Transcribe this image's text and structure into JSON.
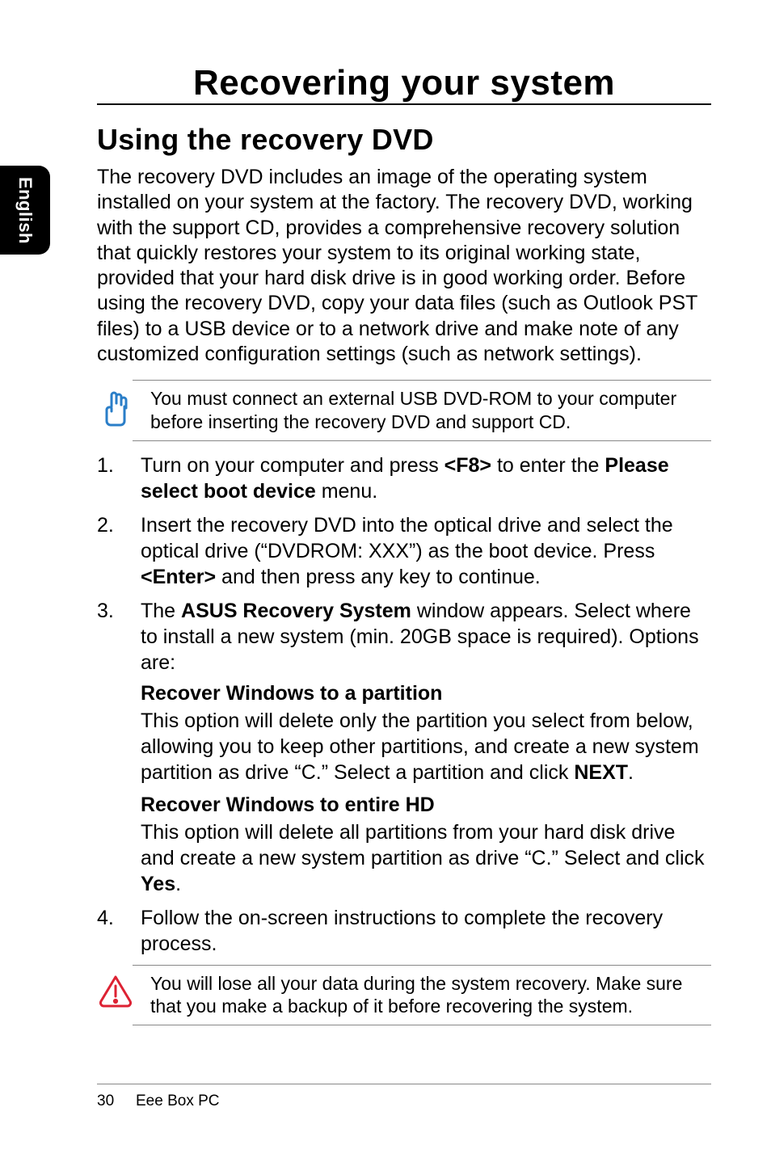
{
  "sideTab": "English",
  "title": "Recovering your system",
  "section": "Using the recovery DVD",
  "intro": "The recovery DVD includes an image of the operating system installed on your system at the factory. The recovery DVD, working with the support CD, provides a comprehensive recovery solution that quickly restores your system to its original working state, provided that your hard disk drive is in good working order. Before using the recovery DVD, copy your data files (such as Outlook PST files) to a USB device or to a network drive and make note of any customized configuration settings (such as network settings).",
  "note1": "You must connect an external USB DVD-ROM to your computer before inserting the recovery DVD and support CD.",
  "steps": {
    "s1a": "Turn on your computer and press ",
    "s1_key": "<F8>",
    "s1b": " to enter the ",
    "s1_bold": "Please select boot device",
    "s1c": " menu.",
    "s2a": "Insert the recovery DVD into the optical drive and select the optical drive (“DVDROM: XXX”) as the boot device. Press ",
    "s2_key": "<Enter>",
    "s2b": " and then press any key to continue.",
    "s3a": "The ",
    "s3_bold": "ASUS Recovery System",
    "s3b": " window appears. Select where to install a new system (min. 20GB space is required). Options are:",
    "s3_opt1_title": "Recover Windows to a partition",
    "s3_opt1_body_a": "This option will delete only the partition you select from below, allowing you to keep other partitions, and create a new system partition as drive “C.” Select a partition and click ",
    "s3_opt1_body_bold": "NEXT",
    "s3_opt1_body_b": ".",
    "s3_opt2_title": "Recover Windows to entire HD",
    "s3_opt2_body_a": "This option will delete all partitions from your hard disk drive and create a new system partition as drive “C.” Select and click ",
    "s3_opt2_body_bold": "Yes",
    "s3_opt2_body_b": ".",
    "s4": "Follow the on-screen instructions to complete the recovery process."
  },
  "warning": "You will lose all your data during the system recovery. Make sure that you make a backup of it before recovering the system.",
  "footer": {
    "page": "30",
    "book": "Eee Box PC"
  }
}
